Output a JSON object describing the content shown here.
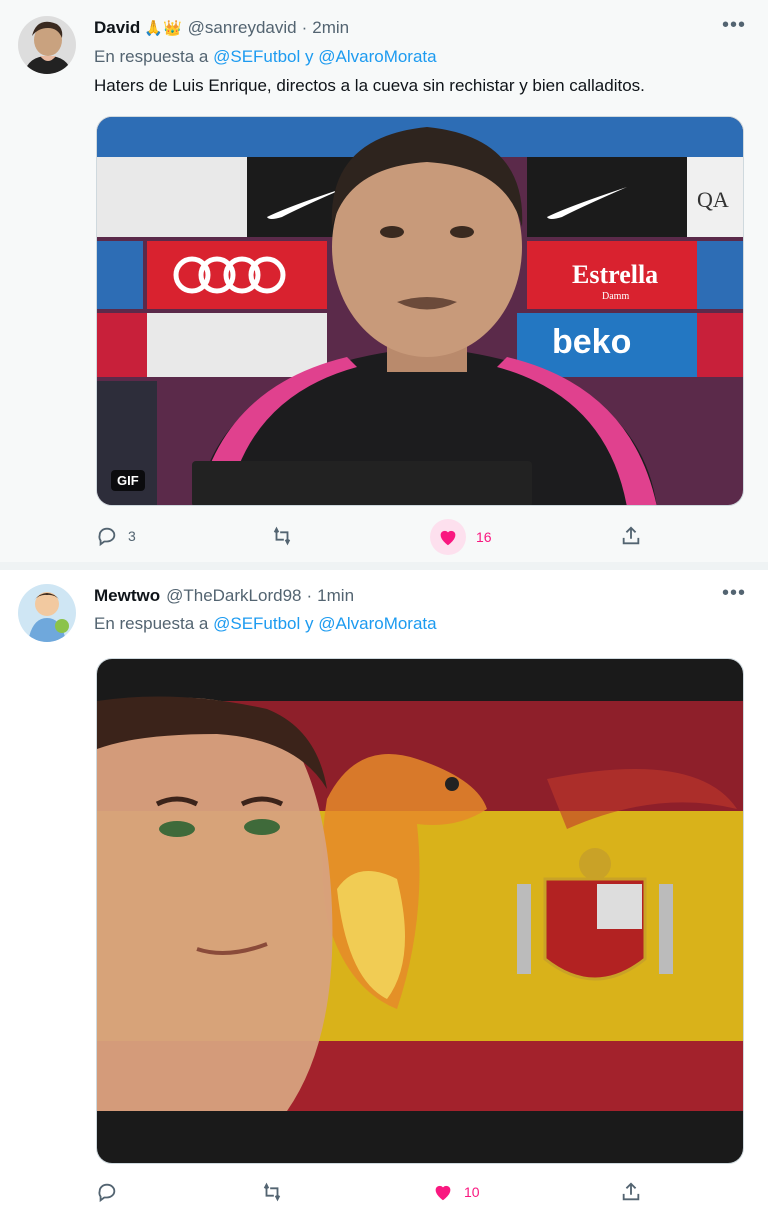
{
  "tweets": [
    {
      "display_name": "David",
      "emoji": "🙏👑",
      "handle": "@sanreydavid",
      "dot": "·",
      "time": "2min",
      "reply_prefix": "En respuesta a",
      "mention_1": "@SEFutbol",
      "conjunction": "y",
      "mention_2": "@AlvaroMorata",
      "text": "Haters de Luis Enrique, directos a la cueva sin rechistar y bien calladitos.",
      "media_badge": "GIF",
      "replies": "3",
      "retweets": "",
      "likes": "16",
      "liked": true
    },
    {
      "display_name": "Mewtwo",
      "handle": "@TheDarkLord98",
      "dot": "·",
      "time": "1min",
      "reply_prefix": "En respuesta a",
      "mention_1": "@SEFutbol",
      "conjunction": "y",
      "mention_2": "@AlvaroMorata",
      "replies": "",
      "retweets": "",
      "likes": "10",
      "liked": true
    }
  ],
  "sponsor_text": {
    "brand_1": "Estrella",
    "brand_1_sub": "Damm",
    "brand_2": "beko",
    "brand_3": "QA"
  },
  "icons": {
    "more": "more-icon",
    "reply": "reply-icon",
    "retweet": "retweet-icon",
    "like": "heart-icon",
    "share": "share-icon"
  },
  "colors": {
    "accent": "#1d9bf0",
    "like": "#f91880",
    "muted": "#536471"
  }
}
